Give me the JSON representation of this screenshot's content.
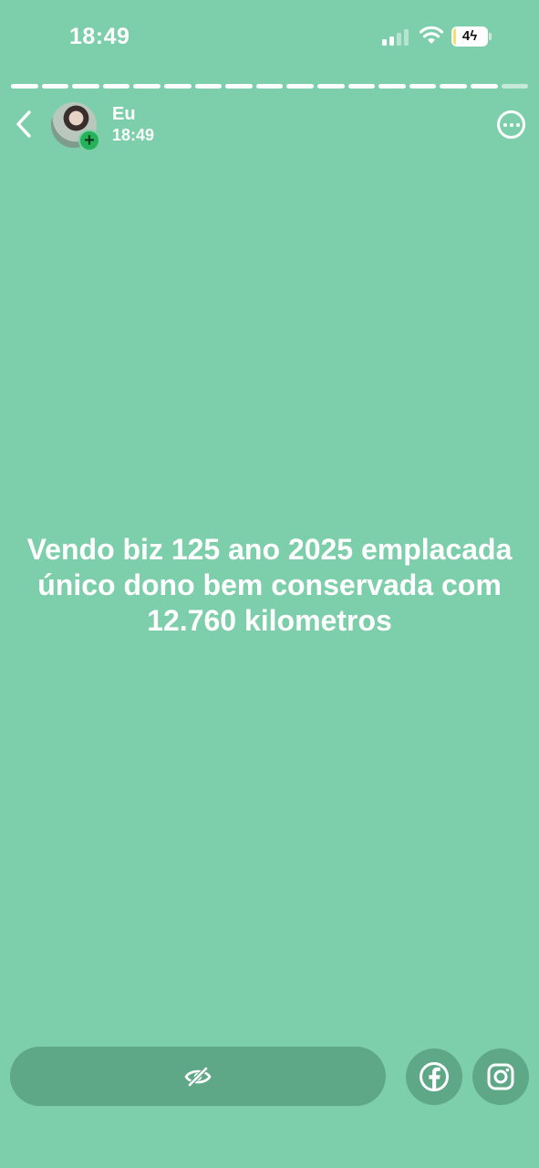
{
  "status_bar": {
    "time": "18:49",
    "battery_level": "4",
    "battery_fraction": 0.04
  },
  "progress": {
    "segments_total": 17,
    "segments_viewed": 16
  },
  "header": {
    "name": "Eu",
    "time": "18:49"
  },
  "story": {
    "text": "Vendo biz 125 ano 2025 emplacada único dono bem conservada com 12.760 kilometros",
    "background_color": "#7dceaa"
  },
  "bottom": {
    "viewers_icon": "eye-off-icon",
    "share_buttons": [
      "facebook-icon",
      "instagram-icon"
    ]
  }
}
